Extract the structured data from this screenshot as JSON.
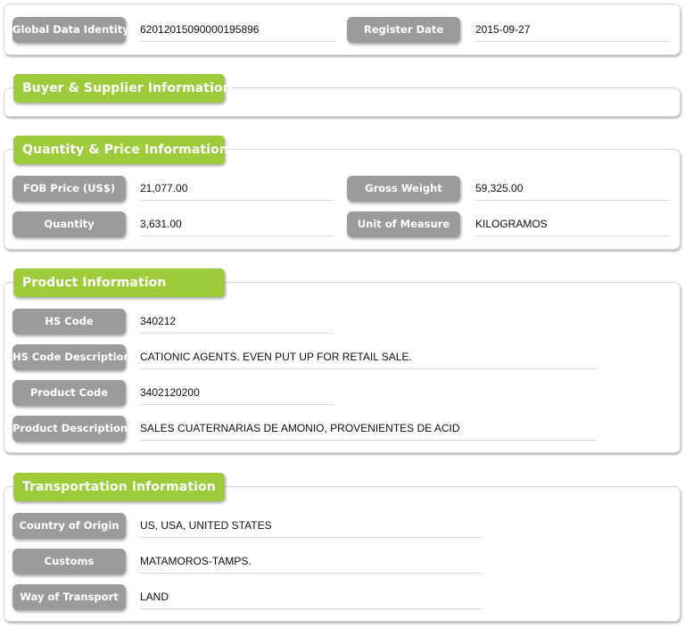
{
  "identity": {
    "global_data_identity": {
      "label": "Global Data Identity",
      "value": "62012015090000195896"
    },
    "register_date": {
      "label": "Register Date",
      "value": "2015-09-27"
    }
  },
  "buyer_supplier": {
    "title": "Buyer & Supplier Information"
  },
  "quantity_price": {
    "title": "Quantity & Price Information",
    "fob_price": {
      "label": "FOB Price (US$)",
      "value": "21,077.00"
    },
    "gross_weight": {
      "label": "Gross Weight",
      "value": "59,325.00"
    },
    "quantity": {
      "label": "Quantity",
      "value": "3,631.00"
    },
    "unit_of_measure": {
      "label": "Unit of Measure",
      "value": "KILOGRAMOS"
    }
  },
  "product": {
    "title": "Product Information",
    "hs_code": {
      "label": "HS Code",
      "value": "340212"
    },
    "hs_code_description": {
      "label": "HS Code Description",
      "value": "CATIONIC AGENTS. EVEN PUT UP FOR RETAIL SALE."
    },
    "product_code": {
      "label": "Product Code",
      "value": "3402120200"
    },
    "product_description": {
      "label": "Product Description",
      "value": "SALES CUATERNARIAS DE AMONIO, PROVENIENTES DE ACID"
    }
  },
  "transportation": {
    "title": "Transportation Information",
    "country_of_origin": {
      "label": "Country of Origin",
      "value": "US, USA, UNITED STATES"
    },
    "customs": {
      "label": "Customs",
      "value": "MATAMOROS-TAMPS."
    },
    "way_of_transport": {
      "label": "Way of Transport",
      "value": "LAND"
    }
  }
}
